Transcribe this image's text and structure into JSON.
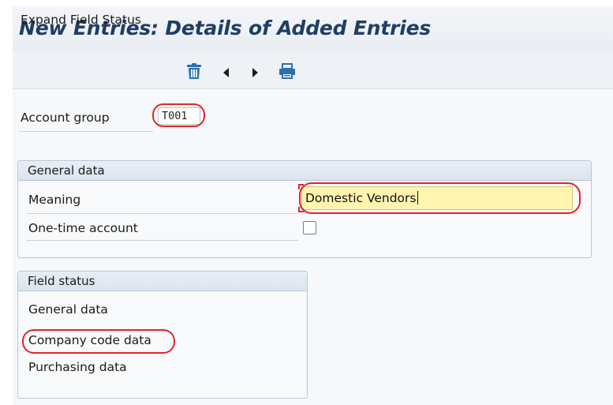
{
  "header": {
    "title": "New Entries: Details of Added Entries"
  },
  "toolbar": {
    "expand_label": "Expand Field Status",
    "icons": [
      "delete-icon",
      "previous-icon",
      "next-icon",
      "print-icon"
    ]
  },
  "account_group": {
    "label": "Account group",
    "value": "T001"
  },
  "general_data": {
    "title": "General data",
    "meaning_label": "Meaning",
    "meaning_value": "Domestic Vendors",
    "one_time_label": "One-time account",
    "one_time_checked": false
  },
  "field_status": {
    "title": "Field status",
    "items": [
      {
        "label": "General data"
      },
      {
        "label": "Company code data"
      },
      {
        "label": "Purchasing data"
      }
    ]
  },
  "colors": {
    "title": "#1f3e63",
    "highlight_oval": "#e0262b",
    "input_focus": "#fff4b0",
    "icon_blue": "#2a6fb5"
  }
}
